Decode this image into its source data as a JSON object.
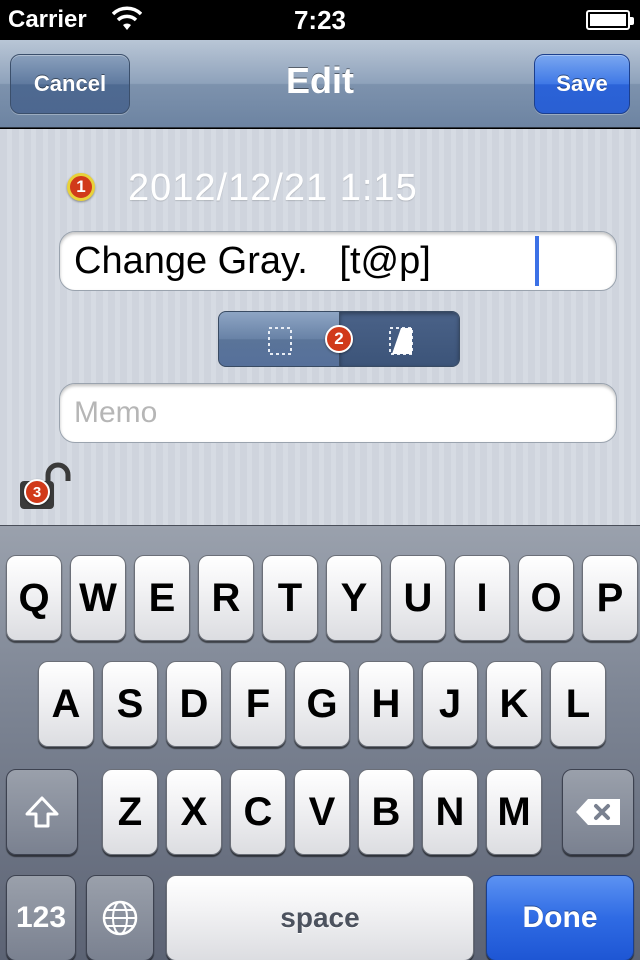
{
  "status_bar": {
    "carrier": "Carrier",
    "time": "7:23"
  },
  "nav": {
    "title": "Edit",
    "cancel_label": "Cancel",
    "save_label": "Save"
  },
  "item": {
    "badge1": "1",
    "datetime": "2012/12/21 1:15",
    "title_value": "Change Gray.   [t@p]",
    "badge2": "2",
    "memo_placeholder": "Memo",
    "badge3": "3"
  },
  "keyboard": {
    "row1": [
      "Q",
      "W",
      "E",
      "R",
      "T",
      "Y",
      "U",
      "I",
      "O",
      "P"
    ],
    "row2": [
      "A",
      "S",
      "D",
      "F",
      "G",
      "H",
      "J",
      "K",
      "L"
    ],
    "row3": [
      "Z",
      "X",
      "C",
      "V",
      "B",
      "N",
      "M"
    ],
    "numbers_label": "123",
    "space_label": "space",
    "done_label": "Done"
  },
  "colors": {
    "accent_blue": "#2f6be4",
    "badge_red": "#d13a1a",
    "caret": "#3c71e6"
  }
}
